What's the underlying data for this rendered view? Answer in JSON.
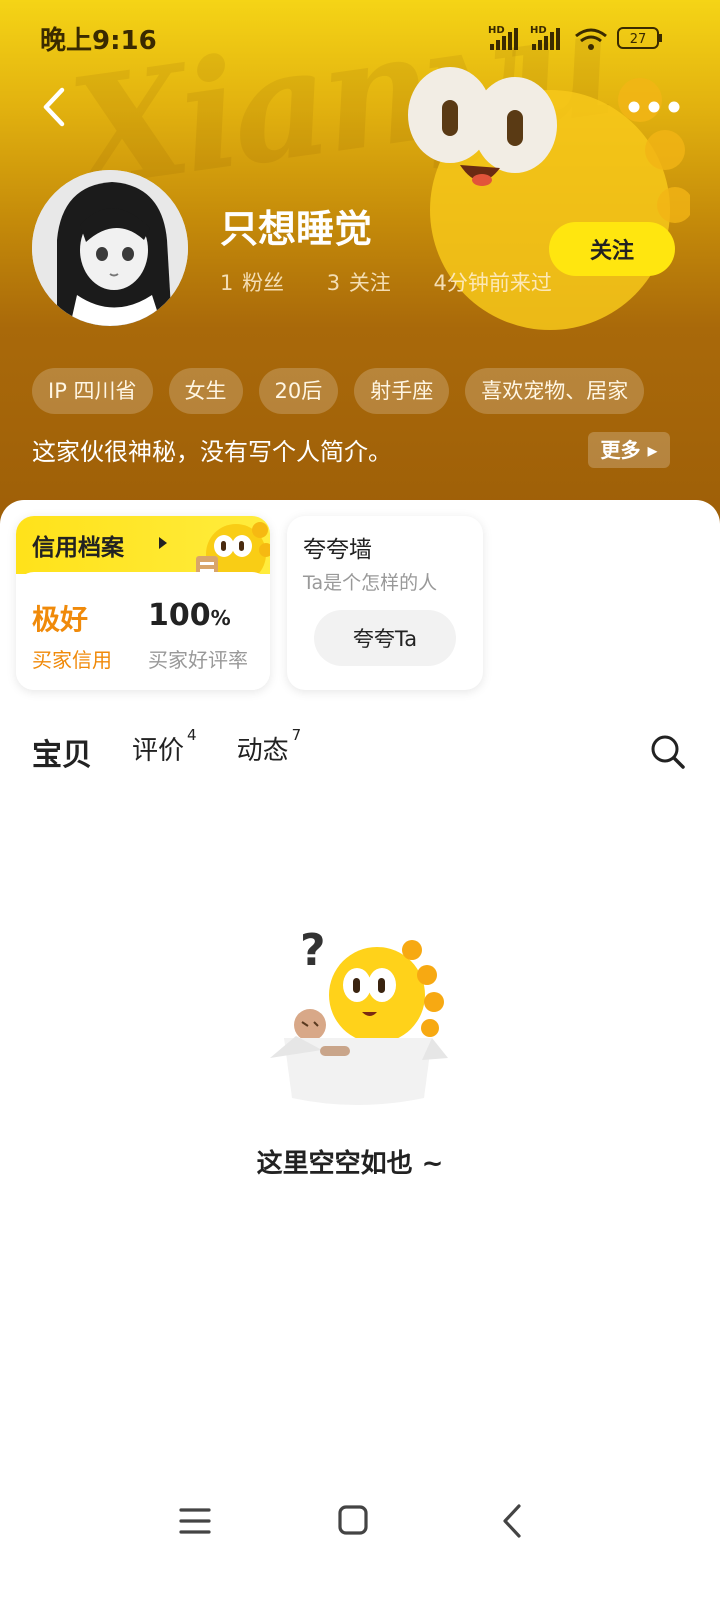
{
  "status_bar": {
    "time": "晚上9:16",
    "battery": "27",
    "network_labels": [
      "HD",
      "HD"
    ]
  },
  "profile": {
    "name": "只想睡觉",
    "stats": [
      {
        "num": "1",
        "label": "粉丝"
      },
      {
        "num": "3",
        "label": "关注"
      }
    ],
    "last_seen": "4分钟前来过",
    "follow_label": "关注",
    "tags": [
      "IP 四川省",
      "女生",
      "20后",
      "射手座",
      "喜欢宠物、居家"
    ],
    "bio": "这家伙很神秘，没有写个人简介。",
    "more_label": "更多"
  },
  "credit": {
    "title": "信用档案",
    "rating": "极好",
    "rating_label": "买家信用",
    "rate_value": "100",
    "rate_unit": "%",
    "rate_label": "买家好评率"
  },
  "kuakua": {
    "title": "夸夸墙",
    "subtitle": "Ta是个怎样的人",
    "button": "夸夸Ta"
  },
  "tabs": [
    {
      "label": "宝贝",
      "count": ""
    },
    {
      "label": "评价",
      "count": "4"
    },
    {
      "label": "动态",
      "count": "7"
    }
  ],
  "empty": {
    "text": "这里空空如也 ~"
  },
  "icons": {
    "back": "back-arrow-icon",
    "more": "more-dots-icon",
    "search": "search-icon",
    "nav": [
      "menu-icon",
      "home-square-icon",
      "back-nav-icon"
    ]
  },
  "colors": {
    "accent": "#ffe60f",
    "credit_orange": "#f08a0a",
    "hero_top": "#f5d416",
    "hero_bottom": "#9e5f08"
  }
}
